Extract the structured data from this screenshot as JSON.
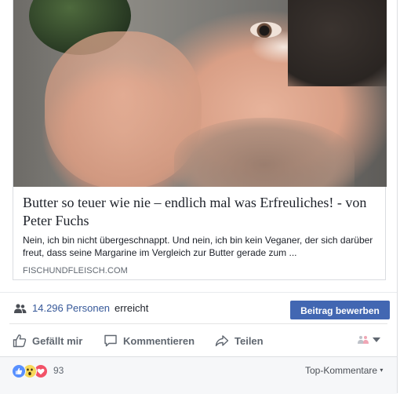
{
  "link_preview": {
    "title": "Butter so teuer wie nie – endlich mal was Erfreuliches! - von Peter Fuchs",
    "description": "Nein, ich bin nicht übergeschnappt. Und nein, ich bin kein Veganer, der sich darüber freut, dass seine Margarine im Vergleich zur Butter gerade zum ...",
    "domain": "FISCHUNDFLEISCH.COM"
  },
  "reach": {
    "icon": "people-icon",
    "count_text": "14.296 Personen",
    "suffix": "erreicht",
    "promote_button": "Beitrag bewerben"
  },
  "actions": {
    "like": "Gefällt mir",
    "comment": "Kommentieren",
    "share": "Teilen"
  },
  "reactions": {
    "types": [
      "like",
      "wow",
      "love"
    ],
    "count": "93",
    "sort_label": "Top-Kommentare"
  },
  "colors": {
    "link_blue": "#365899",
    "button_blue": "#4267b2",
    "secondary_text": "#606770",
    "footer_bg": "#f6f7f9"
  }
}
